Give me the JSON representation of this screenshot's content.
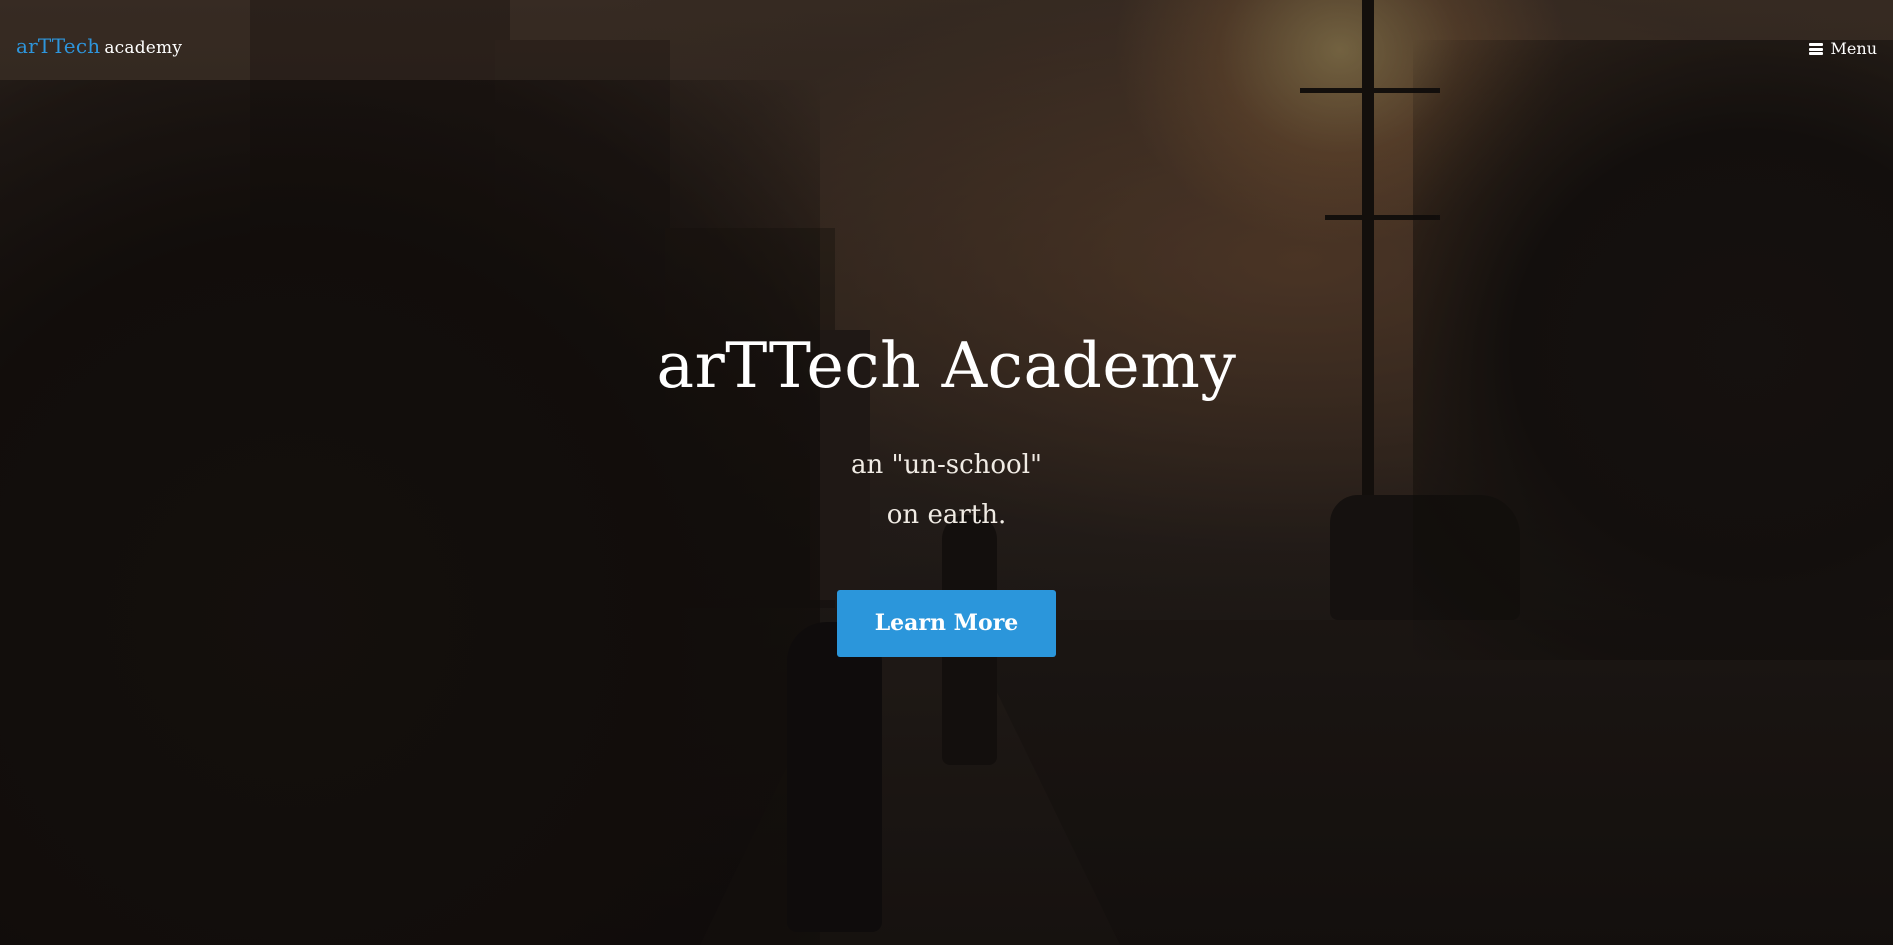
{
  "nav": {
    "brand_main": "arTTech",
    "brand_sub": "academy",
    "menu_label": "Menu",
    "menu_icon": "bars-icon"
  },
  "hero": {
    "title": "arTTech Academy",
    "subtitle_line1": "an \"un-school\"",
    "subtitle_line2": "on earth.",
    "button_label": "Learn More",
    "background_image": "dusk street with silhouettes of a child and adult walking on a sidewalk"
  },
  "colors": {
    "accent": "#2b96db",
    "brand_blue": "#2e95db",
    "text": "#ffffff"
  }
}
